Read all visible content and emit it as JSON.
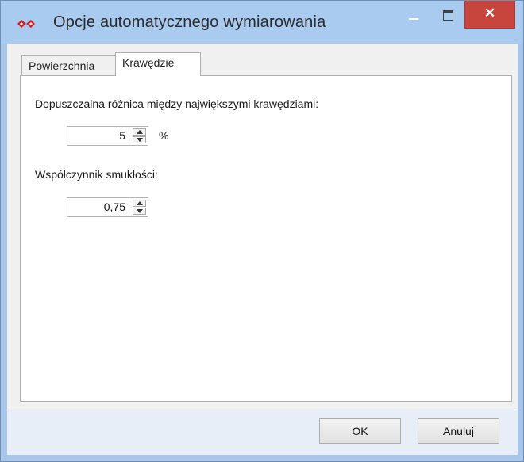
{
  "window": {
    "title": "Opcje automatycznego wymiarowania",
    "close_glyph": "✕",
    "icons": [
      "app-logo-icon",
      "minimize-icon",
      "maximize-icon",
      "close-icon"
    ]
  },
  "tabs": [
    {
      "label": "Powierzchnia",
      "active": false
    },
    {
      "label": "Krawędzie",
      "active": true
    }
  ],
  "edges": {
    "max_edge_diff_label": "Dopuszczalna różnica między największymi krawędziami:",
    "max_edge_diff_value": "5",
    "max_edge_diff_unit": "%",
    "slenderness_label": "Współczynnik smukłości:",
    "slenderness_value": "0,75"
  },
  "buttons": {
    "ok_label": "OK",
    "cancel_label": "Anuluj"
  },
  "colors": {
    "titlebar": "#aacbf0",
    "close_button": "#c7453c",
    "logo": "#cc1f1f"
  }
}
